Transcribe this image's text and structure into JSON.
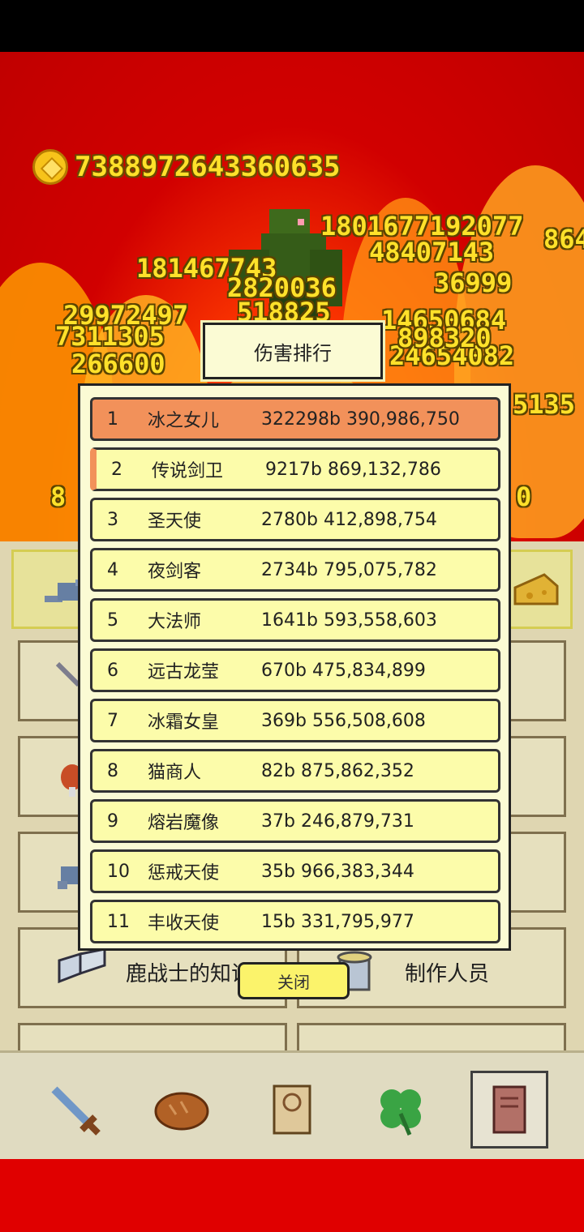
{
  "currency": {
    "amount": "7388972643360635"
  },
  "damage_numbers": [
    "1801677192077",
    "48407143",
    "181467743",
    "2820036",
    "36999",
    "29972497",
    "518825",
    "14650684",
    "7311305",
    "266600",
    "24654082",
    "898320",
    "5135",
    "8",
    "0",
    "864"
  ],
  "leaderboard": {
    "title": "伤害排行",
    "rows": [
      {
        "rank": "1",
        "name": "冰之女儿",
        "value": "322298b 390,986,750"
      },
      {
        "rank": "2",
        "name": "传说剑卫",
        "value": "9217b 869,132,786"
      },
      {
        "rank": "3",
        "name": "圣天使",
        "value": "2780b 412,898,754"
      },
      {
        "rank": "4",
        "name": "夜剑客",
        "value": "2734b 795,075,782"
      },
      {
        "rank": "5",
        "name": "大法师",
        "value": "1641b 593,558,603"
      },
      {
        "rank": "6",
        "name": "远古龙莹",
        "value": "670b 475,834,899"
      },
      {
        "rank": "7",
        "name": "冰霜女皇",
        "value": "369b 556,508,608"
      },
      {
        "rank": "8",
        "name": "猫商人",
        "value": "82b 875,862,352"
      },
      {
        "rank": "9",
        "name": "熔岩魔像",
        "value": "37b 246,879,731"
      },
      {
        "rank": "10",
        "name": "惩戒天使",
        "value": "35b 966,383,344"
      },
      {
        "rank": "11",
        "name": "丰收天使",
        "value": "15b 331,795,977"
      }
    ],
    "close_label": "关闭"
  },
  "menu": {
    "knowledge_label": "鹿战士的知识",
    "credits_label": "制作人员"
  },
  "tabs": [
    "sword-icon",
    "bread-icon",
    "scroll-icon",
    "clover-icon",
    "book-icon"
  ]
}
